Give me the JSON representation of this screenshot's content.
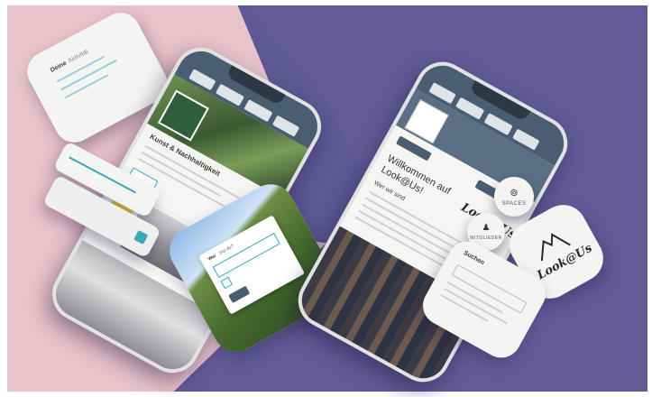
{
  "left_card": {
    "title": "Deine",
    "subtitle": "Aktivität"
  },
  "left_phone": {
    "headline": "Kunst & Nachhaltigkeit"
  },
  "center_card": {
    "title": "Wer",
    "subtitle": "bist du?"
  },
  "right_phone": {
    "welcome_line1": "Willkommen auf",
    "welcome_line2": "Look@Us!",
    "section": "Wer wir sind",
    "script_logo": "Look@Us"
  },
  "chips": {
    "spaces_label": "SPACES",
    "members_label": "MITGLIEDER"
  },
  "logo_card": {
    "logo_text": "Look@Us"
  },
  "search_card": {
    "title": "Suchen"
  },
  "colors": {
    "pink_bg": "#e8c3cb",
    "purple_bg": "#5e5894",
    "header": "#4a5e72",
    "accent": "#3aa8b6"
  }
}
